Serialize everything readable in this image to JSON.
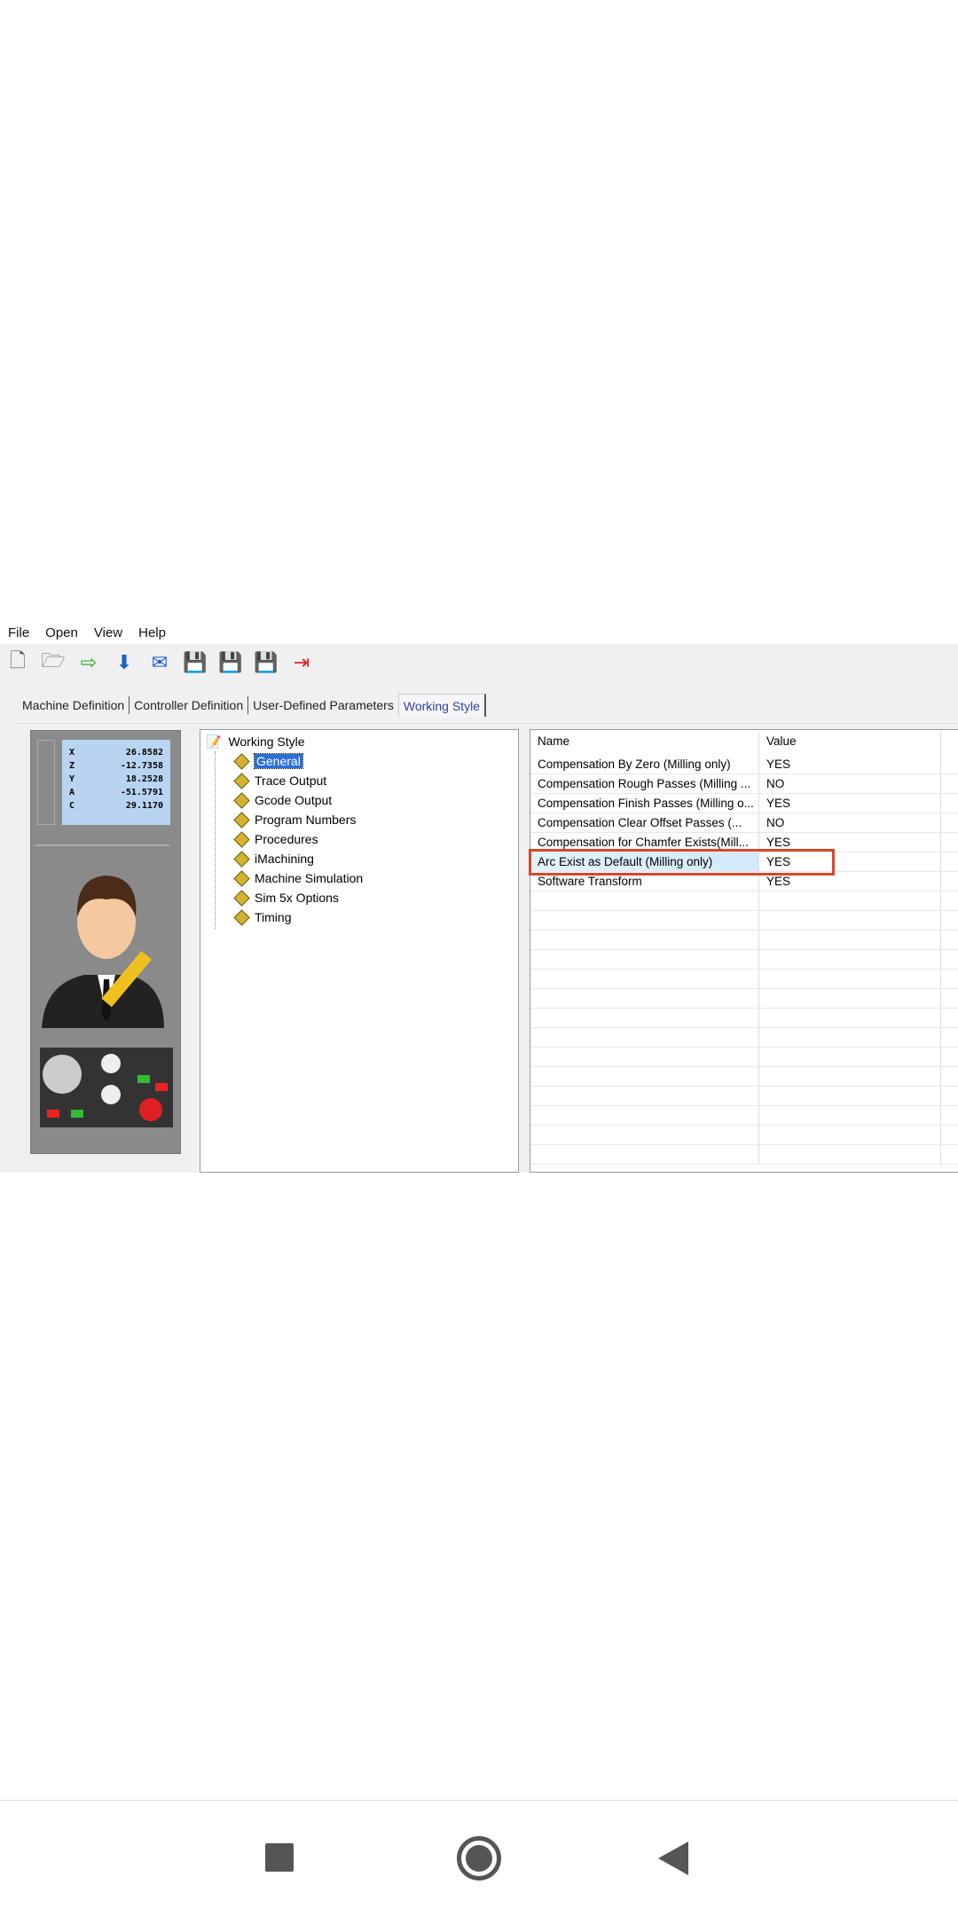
{
  "menu": [
    "File",
    "Open",
    "View",
    "Help"
  ],
  "toolbar": [
    "new-file-icon",
    "open-folder-icon",
    "import-icon",
    "download-folder-icon",
    "export-mail-icon",
    "save-icon",
    "save-new-icon",
    "save-as-icon",
    "exit-icon"
  ],
  "tabs": [
    "Machine Definition",
    "Controller Definition",
    "User-Defined Parameters",
    "Working Style"
  ],
  "active_tab": "Working Style",
  "dro": [
    {
      "axis": "X",
      "value": "26.8582"
    },
    {
      "axis": "Z",
      "value": "-12.7358"
    },
    {
      "axis": "Y",
      "value": "18.2528"
    },
    {
      "axis": "A",
      "value": "-51.5791"
    },
    {
      "axis": "C",
      "value": "29.1170"
    }
  ],
  "tree": {
    "root": "Working Style",
    "items": [
      "General",
      "Trace Output",
      "Gcode Output",
      "Program Numbers",
      "Procedures",
      "iMachining",
      "Machine Simulation",
      "Sim 5x Options",
      "Timing"
    ],
    "selected": "General"
  },
  "table": {
    "headers": [
      "Name",
      "Value"
    ],
    "rows": [
      {
        "name": "Compensation By Zero (Milling only)",
        "value": "YES"
      },
      {
        "name": "Compensation Rough Passes (Milling ...",
        "value": "NO"
      },
      {
        "name": "Compensation Finish Passes (Milling o...",
        "value": "YES"
      },
      {
        "name": "Compensation Clear Offset Passes (...",
        "value": "NO"
      },
      {
        "name": "Compensation for Chamfer Exists(Mill...",
        "value": "YES"
      },
      {
        "name": "Arc Exist as Default (Milling only)",
        "value": "YES"
      },
      {
        "name": "Software Transform",
        "value": "YES"
      }
    ],
    "highlighted_row": 5
  },
  "colors": {
    "highlight": "#d9472b",
    "tab_active": "#3040b0"
  }
}
